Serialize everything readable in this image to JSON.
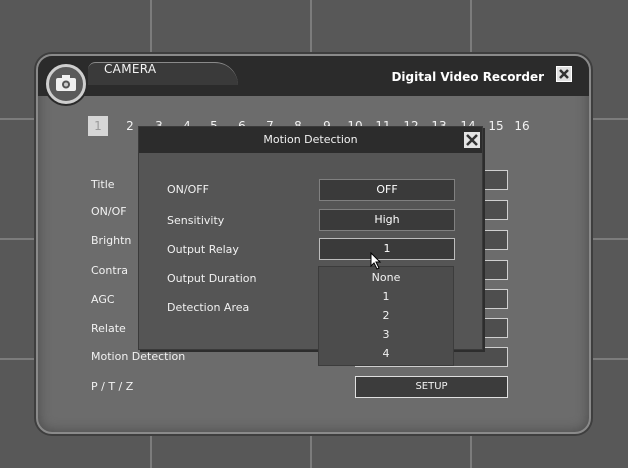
{
  "window": {
    "tab_label": "CAMERA",
    "title": "Digital Video Recorder"
  },
  "channels": [
    "1",
    "2",
    "3",
    "4",
    "5",
    "6",
    "7",
    "8",
    "9",
    "10",
    "11",
    "12",
    "13",
    "14",
    "15",
    "16"
  ],
  "selected_channel": "1",
  "settings": {
    "title_label": "Title",
    "onoff_label": "ON/OF",
    "brightness_label": "Brightn",
    "contrast_label": "Contra",
    "agc_label": "AGC",
    "related_label": "Relate",
    "motion_label": "Motion Detection",
    "ptz_label": "P / T / Z",
    "setup_button": "SETUP"
  },
  "dialog": {
    "title": "Motion Detection",
    "rows": [
      {
        "label": "ON/OFF",
        "value": "OFF"
      },
      {
        "label": "Sensitivity",
        "value": "High"
      },
      {
        "label": "Output Relay",
        "value": "1"
      },
      {
        "label": "Output Duration",
        "value": ""
      },
      {
        "label": "Detection Area",
        "value": ""
      }
    ]
  },
  "dropdown": {
    "options": [
      "None",
      "1",
      "2",
      "3",
      "4"
    ]
  }
}
